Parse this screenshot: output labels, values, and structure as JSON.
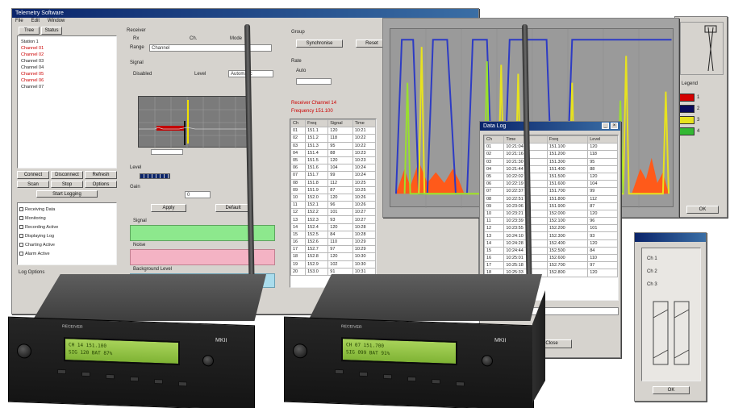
{
  "main_window": {
    "title": "Telemetry Software",
    "menu": [
      "File",
      "Edit",
      "Window"
    ]
  },
  "tree": {
    "header_tabs": [
      "Tree",
      "Status"
    ],
    "items": [
      {
        "text": "Station 1",
        "red": false
      },
      {
        "text": "Channel 01",
        "red": true
      },
      {
        "text": "Channel 02",
        "red": true
      },
      {
        "text": "Channel 03",
        "red": false
      },
      {
        "text": "Channel 04",
        "red": false
      },
      {
        "text": "Channel 05",
        "red": true
      },
      {
        "text": "Channel 06",
        "red": true
      },
      {
        "text": "Channel 07",
        "red": false
      }
    ],
    "buttons": [
      "Connect",
      "Disconnect",
      "Refresh"
    ],
    "small_buttons": [
      "Scan",
      "Stop",
      "Options"
    ],
    "wide_button": "Start Logging"
  },
  "checklist": {
    "items": [
      "Receiving Data",
      "Monitoring",
      "Recording Active",
      "Displaying Log",
      "Charting Active",
      "Alarm Active"
    ],
    "footer_label": "Log Options"
  },
  "settings": {
    "group_label": "Receiver",
    "row1": [
      "Rx",
      "Ch.",
      "Mode"
    ],
    "range_label": "Range",
    "range_value": "Channel",
    "sub_label": "Signal",
    "field1": "Disabled",
    "field2": "Level",
    "field3": "Automatic",
    "bar_label": "Level",
    "spin_label": "Gain",
    "spin_value": "0",
    "btn_apply": "Apply",
    "btn_default": "Default",
    "band1_label": "Signal",
    "band2_label": "Noise",
    "band3_label": "Background Level"
  },
  "mid_panel": {
    "group1_label": "Group",
    "btn_a": "Synchronise",
    "btn_b": "Reset",
    "group2_label": "Rate",
    "rate_value": "Auto",
    "status_line1": "Receiver Channel 14",
    "status_line2": "Frequency 151.100",
    "columns": [
      "Ch",
      "Freq",
      "Signal",
      "Time"
    ],
    "rows": [
      [
        "01",
        "151.1",
        "120",
        "10:21"
      ],
      [
        "02",
        "151.2",
        "118",
        "10:22"
      ],
      [
        "03",
        "151.3",
        "95",
        "10:22"
      ],
      [
        "04",
        "151.4",
        "88",
        "10:23"
      ],
      [
        "05",
        "151.5",
        "120",
        "10:23"
      ],
      [
        "06",
        "151.6",
        "104",
        "10:24"
      ],
      [
        "07",
        "151.7",
        "99",
        "10:24"
      ],
      [
        "08",
        "151.8",
        "112",
        "10:25"
      ],
      [
        "09",
        "151.9",
        "87",
        "10:25"
      ],
      [
        "10",
        "152.0",
        "120",
        "10:26"
      ],
      [
        "11",
        "152.1",
        "96",
        "10:26"
      ],
      [
        "12",
        "152.2",
        "101",
        "10:27"
      ],
      [
        "13",
        "152.3",
        "93",
        "10:27"
      ],
      [
        "14",
        "152.4",
        "120",
        "10:28"
      ],
      [
        "15",
        "152.5",
        "84",
        "10:28"
      ],
      [
        "16",
        "152.6",
        "110",
        "10:29"
      ],
      [
        "17",
        "152.7",
        "97",
        "10:29"
      ],
      [
        "18",
        "152.8",
        "120",
        "10:30"
      ],
      [
        "19",
        "152.9",
        "102",
        "10:30"
      ],
      [
        "20",
        "153.0",
        "91",
        "10:31"
      ]
    ]
  },
  "chart_window": {
    "title": "",
    "chart_data": {
      "type": "line",
      "title": "",
      "xlabel": "",
      "ylabel": "",
      "background": "#9a9a9a",
      "series": [
        {
          "color": "#2d3bc4",
          "points": [
            [
              0.02,
              0.92
            ],
            [
              0.04,
              0.06
            ],
            [
              0.08,
              0.06
            ],
            [
              0.1,
              0.92
            ],
            [
              0.13,
              0.92
            ],
            [
              0.15,
              0.06
            ],
            [
              0.2,
              0.06
            ],
            [
              0.23,
              0.92
            ],
            [
              0.27,
              0.92
            ],
            [
              0.29,
              0.06
            ],
            [
              0.34,
              0.06
            ],
            [
              0.36,
              0.92
            ],
            [
              0.4,
              0.92
            ],
            [
              0.42,
              0.06
            ],
            [
              0.55,
              0.06
            ],
            [
              0.57,
              0.92
            ],
            [
              0.62,
              0.92
            ],
            [
              0.64,
              0.06
            ],
            [
              0.99,
              0.06
            ]
          ]
        },
        {
          "color": "#e7e21f",
          "points": [
            [
              0.1,
              0.92
            ],
            [
              0.11,
              0.1
            ],
            [
              0.12,
              0.92
            ],
            [
              0.38,
              0.92
            ],
            [
              0.39,
              0.2
            ],
            [
              0.4,
              0.92
            ],
            [
              0.44,
              0.92
            ],
            [
              0.45,
              0.25
            ],
            [
              0.46,
              0.92
            ],
            [
              0.63,
              0.92
            ],
            [
              0.64,
              0.3
            ],
            [
              0.65,
              0.92
            ],
            [
              0.82,
              0.92
            ],
            [
              0.83,
              0.15
            ],
            [
              0.84,
              0.92
            ],
            [
              0.96,
              0.92
            ],
            [
              0.97,
              0.35
            ],
            [
              0.98,
              0.92
            ]
          ]
        },
        {
          "color": "#9adf2f",
          "points": [
            [
              0.05,
              0.92
            ],
            [
              0.06,
              0.3
            ],
            [
              0.07,
              0.92
            ],
            [
              0.33,
              0.92
            ],
            [
              0.34,
              0.18
            ],
            [
              0.35,
              0.92
            ],
            [
              0.8,
              0.92
            ],
            [
              0.81,
              0.4
            ],
            [
              0.82,
              0.92
            ]
          ]
        }
      ],
      "fill_series": {
        "color": "#ff5a1a",
        "points": [
          [
            0.02,
            0.92
          ],
          [
            0.05,
            0.78
          ],
          [
            0.07,
            0.88
          ],
          [
            0.1,
            0.74
          ],
          [
            0.13,
            0.86
          ],
          [
            0.16,
            0.8
          ],
          [
            0.19,
            0.86
          ],
          [
            0.22,
            0.78
          ],
          [
            0.24,
            0.84
          ],
          [
            0.26,
            0.92
          ],
          [
            0.85,
            0.92
          ],
          [
            0.88,
            0.78
          ],
          [
            0.9,
            0.84
          ],
          [
            0.92,
            0.72
          ],
          [
            0.94,
            0.86
          ],
          [
            0.96,
            0.8
          ],
          [
            0.98,
            0.92
          ]
        ]
      }
    }
  },
  "legend_window": {
    "swatches": [
      {
        "color": "#d40000",
        "text": "1"
      },
      {
        "color": "#0a0a5a",
        "text": "2"
      },
      {
        "color": "#e7e21f",
        "text": "3"
      },
      {
        "color": "#33b833",
        "text": "4"
      }
    ],
    "label": "Legend",
    "button": "OK"
  },
  "list_window": {
    "title": "Data Log",
    "columns": [
      "Ch",
      "Time",
      "Freq",
      "Level"
    ],
    "rows": [
      [
        "01",
        "10:21:04",
        "151.100",
        "120"
      ],
      [
        "02",
        "10:21:16",
        "151.200",
        "118"
      ],
      [
        "03",
        "10:21:30",
        "151.300",
        "95"
      ],
      [
        "04",
        "10:21:44",
        "151.400",
        "88"
      ],
      [
        "05",
        "10:22:02",
        "151.500",
        "120"
      ],
      [
        "06",
        "10:22:19",
        "151.600",
        "104"
      ],
      [
        "07",
        "10:22:37",
        "151.700",
        "99"
      ],
      [
        "08",
        "10:22:51",
        "151.800",
        "112"
      ],
      [
        "09",
        "10:23:06",
        "151.900",
        "87"
      ],
      [
        "10",
        "10:23:21",
        "152.000",
        "120"
      ],
      [
        "11",
        "10:23:39",
        "152.100",
        "96"
      ],
      [
        "12",
        "10:23:55",
        "152.200",
        "101"
      ],
      [
        "13",
        "10:24:10",
        "152.300",
        "93"
      ],
      [
        "14",
        "10:24:28",
        "152.400",
        "120"
      ],
      [
        "15",
        "10:24:44",
        "152.500",
        "84"
      ],
      [
        "16",
        "10:25:01",
        "152.600",
        "110"
      ],
      [
        "17",
        "10:25:18",
        "152.700",
        "97"
      ],
      [
        "18",
        "10:25:33",
        "152.800",
        "120"
      ]
    ],
    "footer_button": "Close"
  },
  "bottom_window": {
    "title": "",
    "labels": [
      "Ch 1",
      "Ch 2",
      "Ch 3"
    ],
    "button": "OK"
  },
  "devices": [
    {
      "badge": "MKII",
      "lcd_line1": "CH 14  151.100",
      "lcd_line2": "SIG 120  BAT 87%",
      "label": "RECEIVER"
    },
    {
      "badge": "MKII",
      "lcd_line1": "CH 07  151.700",
      "lcd_line2": "SIG 099  BAT 91%",
      "label": "RECEIVER"
    }
  ]
}
